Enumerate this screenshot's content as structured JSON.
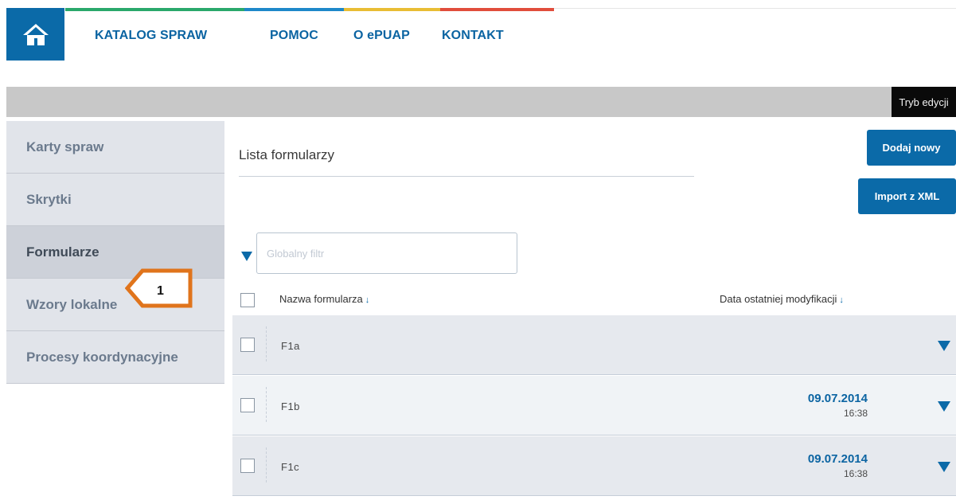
{
  "colors": {
    "primary": "#0b6aa8",
    "stripe": [
      "#2aa86b",
      "#1e88c9",
      "#e9bd34",
      "#e14d3c"
    ]
  },
  "nav": {
    "home_icon": "home-icon",
    "items": [
      "KATALOG SPRAW",
      "POMOC",
      "O ePUAP",
      "KONTAKT"
    ]
  },
  "toolbar": {
    "edit_mode": "Tryb edycji"
  },
  "sidebar": {
    "items": [
      {
        "label": "Karty spraw"
      },
      {
        "label": "Skrytki"
      },
      {
        "label": "Formularze"
      },
      {
        "label": "Wzory lokalne"
      },
      {
        "label": "Procesy koordynacyjne"
      }
    ],
    "active": "Formularze"
  },
  "callout": {
    "number": "1"
  },
  "main": {
    "title": "Lista formularzy",
    "add_button": "Dodaj nowy",
    "import_button": "Import z XML",
    "filter": {
      "placeholder": "Globalny filtr"
    },
    "table": {
      "columns": [
        "Nazwa formularza",
        "Data ostatniej modyfikacji"
      ],
      "sort_indicator": "↓",
      "rows": [
        {
          "name": "F1a",
          "date": "",
          "time": ""
        },
        {
          "name": "F1b",
          "date": "09.07.2014",
          "time": "16:38"
        },
        {
          "name": "F1c",
          "date": "09.07.2014",
          "time": "16:38"
        }
      ]
    }
  }
}
